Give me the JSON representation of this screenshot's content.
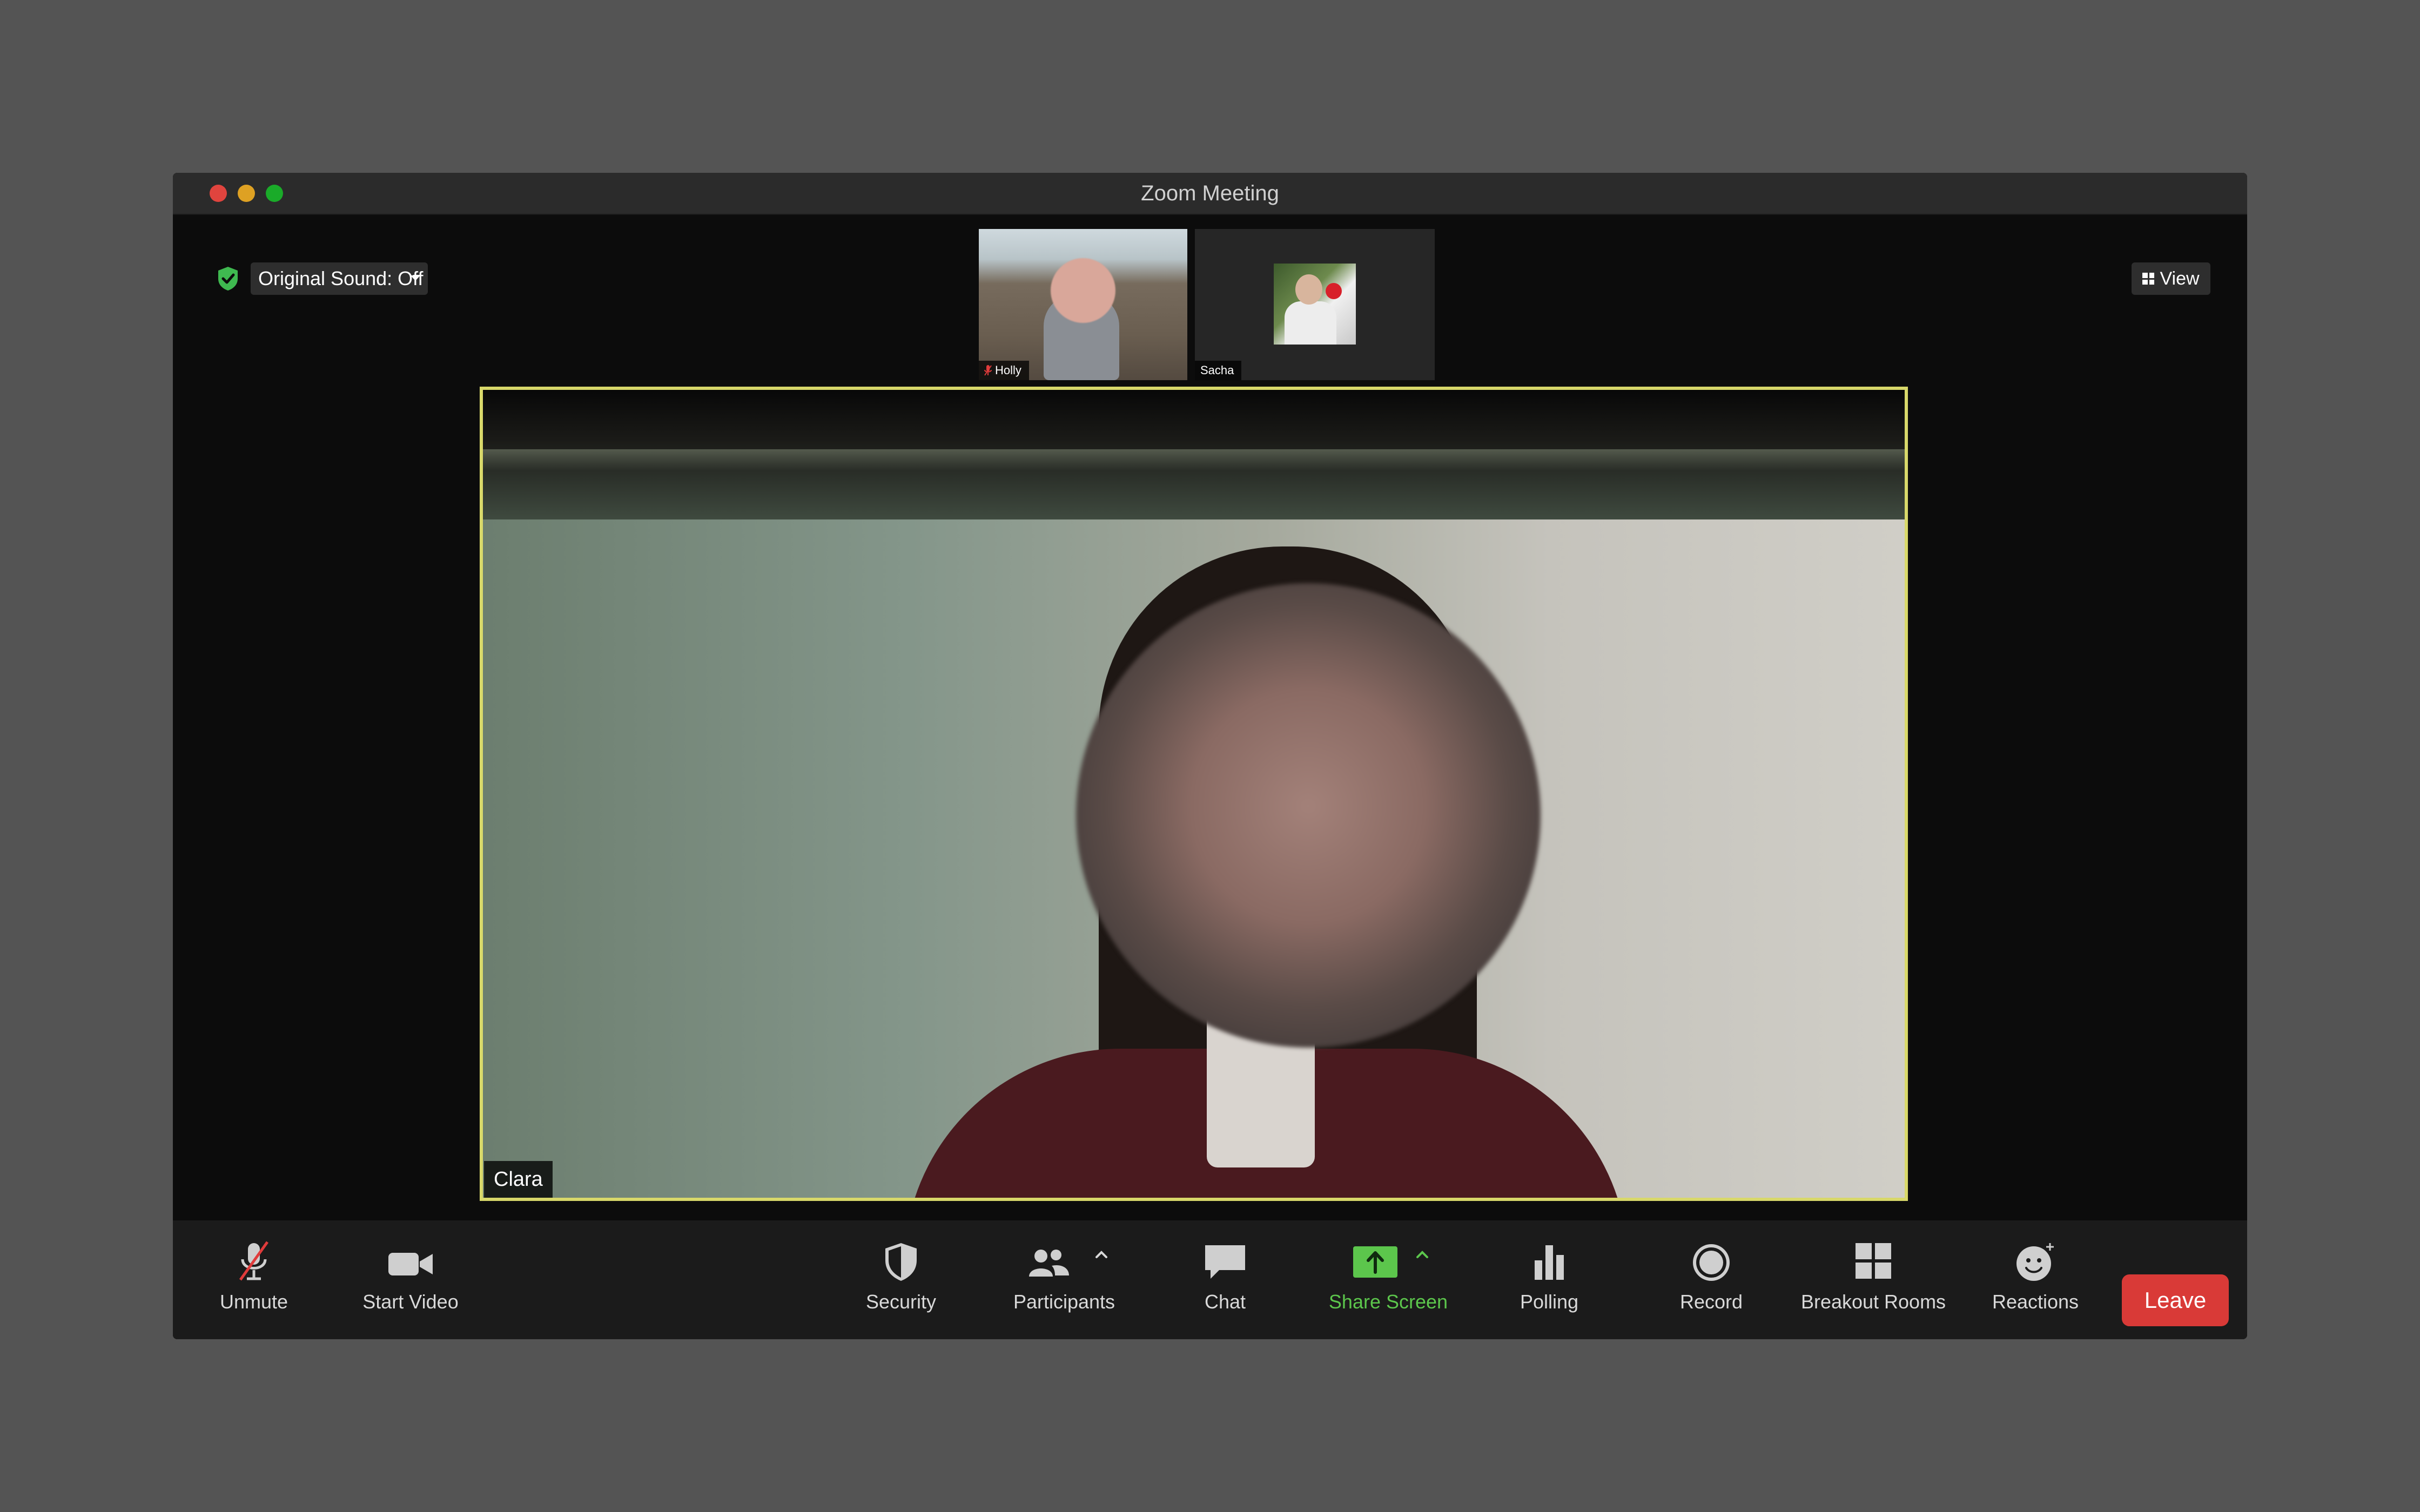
{
  "window": {
    "title": "Zoom Meeting"
  },
  "top_controls": {
    "original_sound_label": "Original Sound: Off",
    "view_label": "View",
    "security_status_icon": "shield-check-icon"
  },
  "thumbnails": [
    {
      "name": "Holly",
      "muted": true
    },
    {
      "name": "Sacha",
      "muted": false
    }
  ],
  "main_video": {
    "speaker_name": "Clara",
    "active_speaker_border": "#d8d86a"
  },
  "toolbar": {
    "unmute": "Unmute",
    "start_video": "Start Video",
    "security": "Security",
    "participants": "Participants",
    "chat": "Chat",
    "share_screen": "Share Screen",
    "polling": "Polling",
    "record": "Record",
    "breakout_rooms": "Breakout Rooms",
    "reactions": "Reactions",
    "leave": "Leave"
  },
  "colors": {
    "accent_green": "#5cc64c",
    "leave_red": "#d93a37",
    "muted_red": "#e03b3b"
  }
}
